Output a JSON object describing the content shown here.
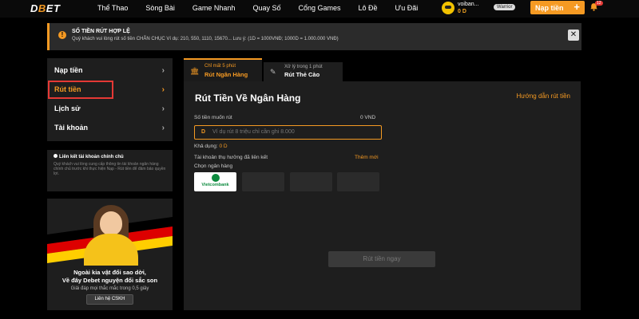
{
  "header": {
    "logo_main": "D",
    "logo_accent": "B",
    "logo_rest_1": "E",
    "logo_rest_2": "ET",
    "nav": [
      "Thể Thao",
      "Sòng Bài",
      "Game Nhanh",
      "Quay Số",
      "Cổng Games",
      "Lô Đề",
      "Ưu Đãi"
    ],
    "username": "voiban...",
    "balance": "0 D",
    "rank": "Warrior",
    "deposit_label": "Nạp tiền",
    "deposit_plus": "+",
    "notification_count": "12"
  },
  "notice": {
    "icon": "!",
    "title": "SỐ TIỀN RÚT HỢP LỆ",
    "text": "Quý khách vui lòng rút số tiền CHẴN CHỤC Ví dụ: 210, 550, 1110, 15670... Lưu ý: (1D = 1000VNĐ; 1000D = 1.000.000 VNĐ)",
    "close": "✕"
  },
  "sidebar": {
    "items": [
      {
        "label": "Nạp tiền",
        "chevron": "›"
      },
      {
        "label": "Rút tiền",
        "chevron": "›"
      },
      {
        "label": "Lịch sử",
        "chevron": "›"
      },
      {
        "label": "Tài khoản",
        "chevron": "›"
      }
    ],
    "bank_hint_title": "Liên kết tài khoản chính chủ",
    "bank_hint_text": "Quý khách vui lòng cung cấp thông tin tài khoản ngân hàng chính chủ trước khi thực hiện Nạp - Rút tiền để đảm bảo quyền lợi."
  },
  "support": {
    "line1": "Ngoài kia vật đổi sao dời,",
    "line2": "Về đây Debet nguyện đổi sắc son",
    "sub": "Giải đáp mọi thắc mắc trong 0,5 giây",
    "button": "Liên hệ CSKH",
    "flag_colors": [
      "#000000",
      "#dd0000",
      "#ffce00"
    ]
  },
  "tabs": [
    {
      "sub": "Chỉ mất 5 phút",
      "title": "Rút Ngân Hàng",
      "icon": "bank-icon",
      "glyph": "🏛"
    },
    {
      "sub": "Xử lý trong 1 phút",
      "title": "Rút Thẻ Cào",
      "icon": "card-icon",
      "glyph": "✎"
    }
  ],
  "main": {
    "title": "Rút Tiền Về Ngân Hàng",
    "guide_link": "Hướng dẫn rút tiền",
    "amount_label": "Số tiền muốn rút",
    "amount_unit": "0 VND",
    "input_prefix": "D",
    "input_placeholder": "Ví dụ rút 8 triệu chỉ cần ghi 8.000",
    "available_label": "Khả dụng:",
    "available_value": "0 D",
    "linked_accounts_label": "Tài khoản thụ hưởng đã liên kết",
    "add_new": "Thêm mới",
    "choose_bank_label": "Chọn ngân hàng",
    "banks": [
      "Vietcombank",
      "",
      "",
      ""
    ],
    "withdraw_button": "Rút tiền ngay"
  },
  "colors": {
    "accent": "#f59a23",
    "highlight_border": "#e53935",
    "panel": "#1e1e1e"
  }
}
